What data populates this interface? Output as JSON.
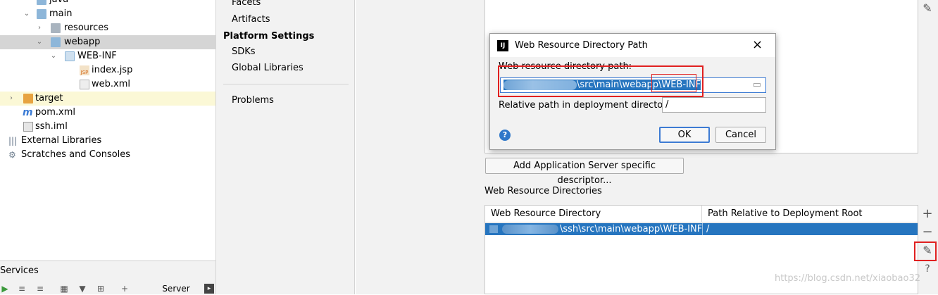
{
  "tree": {
    "items": [
      {
        "label": "java"
      },
      {
        "label": "main"
      },
      {
        "label": "resources"
      },
      {
        "label": "webapp"
      },
      {
        "label": "WEB-INF"
      },
      {
        "label": "index.jsp"
      },
      {
        "label": "web.xml"
      },
      {
        "label": "target"
      },
      {
        "label": "pom.xml"
      },
      {
        "label": "ssh.iml"
      },
      {
        "label": "External Libraries"
      },
      {
        "label": "Scratches and Consoles"
      }
    ]
  },
  "services": {
    "title": "Services",
    "tab_label": "Server"
  },
  "nav": {
    "facets": "Facets",
    "artifacts": "Artifacts",
    "platform_settings": "Platform Settings",
    "sdks": "SDKs",
    "global_libraries": "Global Libraries",
    "problems": "Problems"
  },
  "right": {
    "add_descriptor_button": "Add Application Server specific descriptor...",
    "web_resource_directories_label": "Web Resource Directories",
    "table": {
      "col1": "Web Resource Directory",
      "col2": "Path Relative to Deployment Root",
      "row": {
        "dir": "\\ssh\\src\\main\\webapp\\WEB-INF",
        "path": "/"
      }
    },
    "side_icons": [
      "edit-icon",
      "plus-icon",
      "minus-icon",
      "edit-icon",
      "help-icon"
    ]
  },
  "dialog": {
    "title": "Web Resource Directory Path",
    "close_glyph": "×",
    "dir_label": "Web resource directory path:",
    "dir_value_visible": "\\src\\main\\webapp\\",
    "dir_value_tail": "WEB-INF",
    "rel_label": "Relative path in deployment directory:",
    "rel_value": "/",
    "ok": "OK",
    "cancel": "Cancel",
    "help_glyph": "?"
  },
  "watermark": "https://blog.csdn.net/xiaobao32",
  "colors": {
    "selection": "#2675bf",
    "annotation_red": "#e02020",
    "accent_focus": "#3d7bd3"
  }
}
